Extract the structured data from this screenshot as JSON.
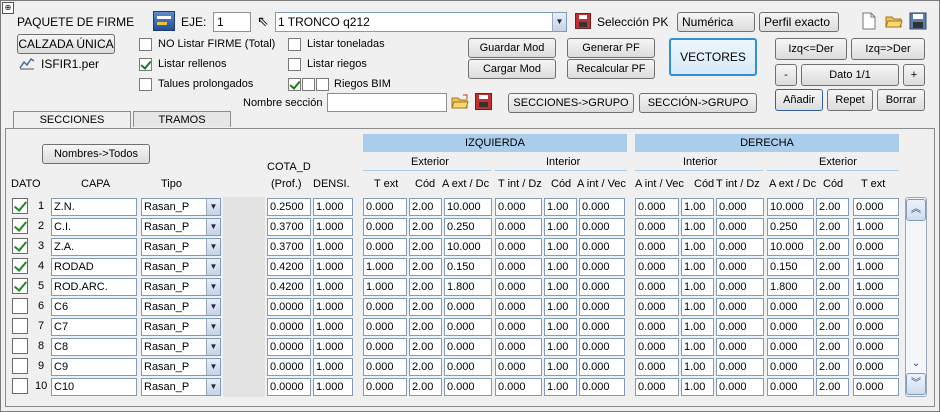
{
  "header": {
    "title": "PAQUETE DE FIRME",
    "calzada_button": "CALZADA ÚNICA",
    "file_name": "ISFIR1.per",
    "eje_label": "EJE:",
    "eje_value": "1",
    "eje_select": "1 TRONCO q212",
    "seleccion_pk": "Selección PK",
    "numerica_button": "Numérica",
    "perfil_button": "Perfil exacto",
    "seccion_nombre_label": "Nombre sección",
    "seccion_nombre_value": ""
  },
  "options": {
    "no_listar_firme": "NO Listar FIRME (Total)",
    "listar_rellenos": "Listar rellenos",
    "talues_prolongados": "Talues prolongados",
    "listar_toneladas": "Listar toneladas",
    "listar_riegos": "Listar riegos",
    "riegos_bim": "Riegos BIM"
  },
  "buttons": {
    "guardar_mod": "Guardar Mod",
    "cargar_mod": "Cargar Mod",
    "generar_pf": "Generar PF",
    "recalcular_pf": "Recalcular PF",
    "vectores": "VECTORES",
    "izq_der": "Izq<=Der",
    "izq_der2": "Izq=>Der",
    "minus": "-",
    "dato": "Dato 1/1",
    "plus": "+",
    "anadir": "Añadir",
    "repet": "Repet",
    "borrar": "Borrar",
    "secciones_grupo": "SECCIONES->GRUPO",
    "seccion_grupo": "SECCIÓN->GRUPO",
    "nombres_todos": "Nombres->Todos"
  },
  "tabs": [
    {
      "label": "SECCIONES"
    },
    {
      "label": "TRAMOS"
    }
  ],
  "table": {
    "izquierda": "IZQUIERDA",
    "derecha": "DERECHA",
    "exterior": "Exterior",
    "interior": "Interior",
    "interior_r": "Interior",
    "exterior_r": "Exterior",
    "cota_d": "COTA_D",
    "prof": "(Prof.)",
    "densi": "DENSI.",
    "dato": "DATO",
    "capa": "CAPA",
    "tipo": "Tipo",
    "cols": {
      "t_ext": "T ext",
      "cod": "Cód",
      "a_ext_dc": "A ext / Dc",
      "t_int_dz": "T int / Dz",
      "cod2": "Cód",
      "a_int_vec": "A int / Vec",
      "a_int_vec_r": "A int / Vec",
      "cod3": "Cód",
      "t_int_dz_r": "T int / Dz",
      "a_ext_dc_r": "A ext / Dc",
      "cod4": "Cód",
      "t_ext_r": "T ext"
    },
    "rows": [
      {
        "n": "1",
        "checked": true,
        "capa": "Z.N.",
        "tipo": "Rasan_P",
        "cota": "0.2500",
        "densi": "1.000",
        "v": [
          "0.000",
          "2.00",
          "10.000",
          "0.000",
          "1.00",
          "0.000",
          "0.000",
          "1.00",
          "0.000",
          "10.000",
          "2.00",
          "0.000"
        ]
      },
      {
        "n": "2",
        "checked": true,
        "capa": "C.I.",
        "tipo": "Rasan_P",
        "cota": "0.3700",
        "densi": "1.000",
        "v": [
          "0.000",
          "2.00",
          "0.250",
          "0.000",
          "1.00",
          "0.000",
          "0.000",
          "1.00",
          "0.000",
          "0.250",
          "2.00",
          "1.000"
        ]
      },
      {
        "n": "3",
        "checked": true,
        "capa": "Z.A.",
        "tipo": "Rasan_P",
        "cota": "0.3700",
        "densi": "1.000",
        "v": [
          "0.000",
          "2.00",
          "10.000",
          "0.000",
          "1.00",
          "0.000",
          "0.000",
          "1.00",
          "0.000",
          "10.000",
          "2.00",
          "0.000"
        ]
      },
      {
        "n": "4",
        "checked": true,
        "capa": "RODAD",
        "tipo": "Rasan_P",
        "cota": "0.4200",
        "densi": "1.000",
        "v": [
          "1.000",
          "2.00",
          "0.150",
          "0.000",
          "1.00",
          "0.000",
          "0.000",
          "1.00",
          "0.000",
          "0.150",
          "2.00",
          "1.000"
        ]
      },
      {
        "n": "5",
        "checked": true,
        "capa": "ROD.ARC.",
        "tipo": "Rasan_P",
        "cota": "0.4200",
        "densi": "1.000",
        "v": [
          "1.000",
          "2.00",
          "1.800",
          "0.000",
          "1.00",
          "0.000",
          "0.000",
          "1.00",
          "0.000",
          "1.800",
          "2.00",
          "1.000"
        ]
      },
      {
        "n": "6",
        "checked": false,
        "capa": "C6",
        "tipo": "Rasan_P",
        "cota": "0.0000",
        "densi": "1.000",
        "v": [
          "0.000",
          "2.00",
          "0.000",
          "0.000",
          "1.00",
          "0.000",
          "0.000",
          "1.00",
          "0.000",
          "0.000",
          "2.00",
          "0.000"
        ]
      },
      {
        "n": "7",
        "checked": false,
        "capa": "C7",
        "tipo": "Rasan_P",
        "cota": "0.0000",
        "densi": "1.000",
        "v": [
          "0.000",
          "2.00",
          "0.000",
          "0.000",
          "1.00",
          "0.000",
          "0.000",
          "1.00",
          "0.000",
          "0.000",
          "2.00",
          "0.000"
        ]
      },
      {
        "n": "8",
        "checked": false,
        "capa": "C8",
        "tipo": "Rasan_P",
        "cota": "0.0000",
        "densi": "1.000",
        "v": [
          "0.000",
          "2.00",
          "0.000",
          "0.000",
          "1.00",
          "0.000",
          "0.000",
          "1.00",
          "0.000",
          "0.000",
          "2.00",
          "0.000"
        ]
      },
      {
        "n": "9",
        "checked": false,
        "capa": "C9",
        "tipo": "Rasan_P",
        "cota": "0.0000",
        "densi": "1.000",
        "v": [
          "0.000",
          "2.00",
          "0.000",
          "0.000",
          "1.00",
          "0.000",
          "0.000",
          "1.00",
          "0.000",
          "0.000",
          "2.00",
          "0.000"
        ]
      },
      {
        "n": "10",
        "checked": false,
        "capa": "C10",
        "tipo": "Rasan_P",
        "cota": "0.0000",
        "densi": "1.000",
        "v": [
          "0.000",
          "2.00",
          "0.000",
          "0.000",
          "1.00",
          "0.000",
          "0.000",
          "1.00",
          "0.000",
          "0.000",
          "2.00",
          "0.000"
        ]
      }
    ]
  },
  "colors": {
    "accent": "#a9cdea",
    "vectores_border": "#2f8fd8",
    "check_green": "#1c8a1c"
  }
}
